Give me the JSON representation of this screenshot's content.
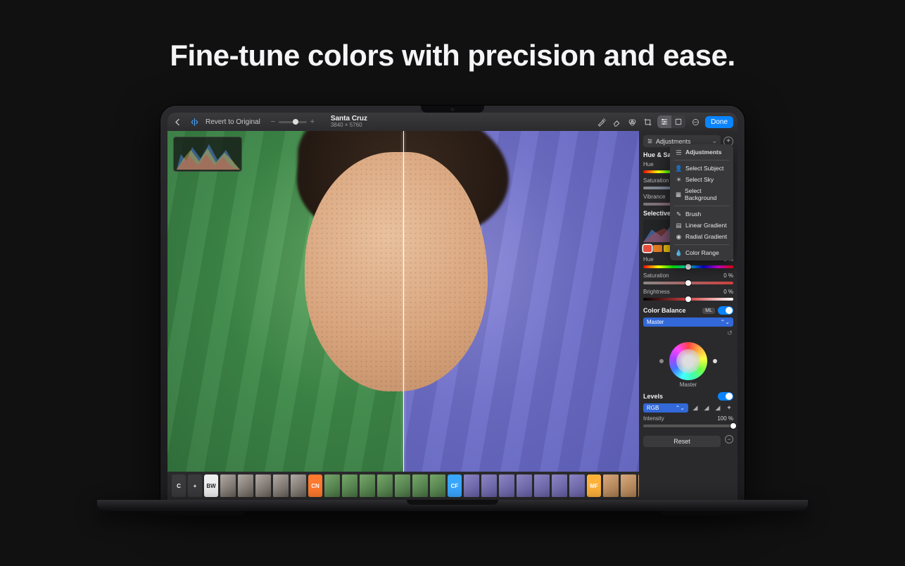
{
  "headline": "Fine-tune colors with precision and ease.",
  "toolbar": {
    "revert": "Revert to Original",
    "title": "Santa Cruz",
    "dimensions": "3840 × 5760",
    "done": "Done"
  },
  "panel": {
    "adjustments_label": "Adjustments",
    "hue_sat": {
      "title": "Hue & Saturation",
      "hue_label": "Hue",
      "saturation_label": "Saturation",
      "vibrance_label": "Vibrance"
    },
    "selective": {
      "title": "Selective Color",
      "hue_label": "Hue",
      "hue_value": "0 %",
      "saturation_label": "Saturation",
      "saturation_value": "0 %",
      "brightness_label": "Brightness",
      "brightness_value": "0 %",
      "swatches": [
        "#e74c3c",
        "#e67e22",
        "#f1c40f",
        "#2ecc71",
        "#1abc9c",
        "#3498db",
        "#5b6ee1",
        "#9b59b6",
        "#e84393"
      ]
    },
    "color_balance": {
      "title": "Color Balance",
      "ml": "ML",
      "master_select": "Master",
      "wheel_label": "Master"
    },
    "levels": {
      "title": "Levels",
      "rgb_select": "RGB",
      "intensity_label": "Intensity",
      "intensity_value": "100 %"
    },
    "reset": "Reset"
  },
  "dropdown": {
    "header": "Adjustments",
    "items_a": [
      "Select Subject",
      "Select Sky",
      "Select Background"
    ],
    "items_b": [
      "Brush",
      "Linear Gradient",
      "Radial Gradient"
    ],
    "items_c": [
      "Color Range"
    ]
  },
  "filmstrip": {
    "tags": {
      "c": "C",
      "plus": "+",
      "bw": "BW",
      "cn": "CN",
      "cf": "CF",
      "mf": "MF"
    }
  }
}
